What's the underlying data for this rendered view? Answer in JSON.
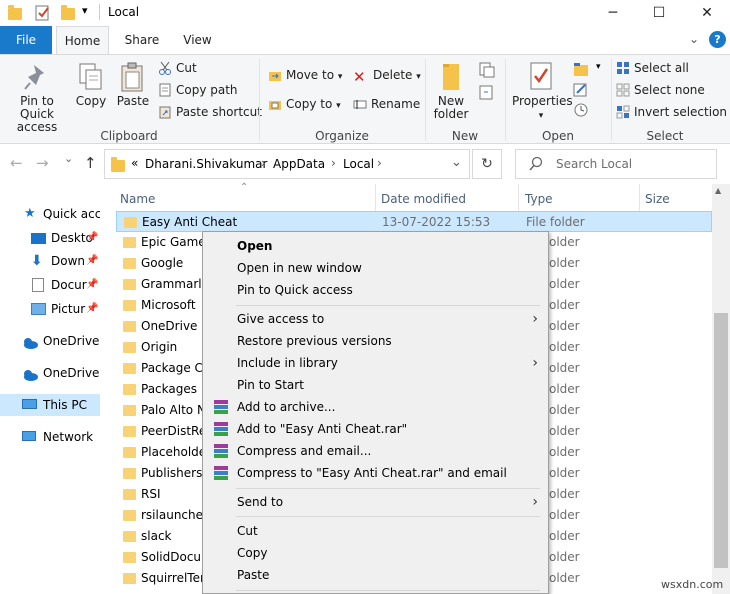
{
  "window": {
    "title": "Local",
    "minimize": "─",
    "maximize": "☐",
    "close": "✕"
  },
  "tabs": {
    "file": "File",
    "home": "Home",
    "share": "Share",
    "view": "View",
    "help": "?",
    "collapse": "⌄"
  },
  "ribbon": {
    "clipboard": {
      "pin": "Pin to Quick access",
      "copy": "Copy",
      "paste": "Paste",
      "cut": "Cut",
      "copy_path": "Copy path",
      "paste_shortcut": "Paste shortcut",
      "label": "Clipboard"
    },
    "organize": {
      "move_to": "Move to",
      "copy_to": "Copy to",
      "delete": "Delete",
      "rename": "Rename",
      "label": "Organize"
    },
    "new": {
      "new_folder": "New folder",
      "label": "New"
    },
    "open": {
      "properties": "Properties",
      "label": "Open"
    },
    "select": {
      "select_all": "Select all",
      "select_none": "Select none",
      "invert": "Invert selection",
      "label": "Select"
    }
  },
  "address": {
    "back": "←",
    "forward": "→",
    "recent": "⌄",
    "up": "↑",
    "overflow": "«",
    "crumbs": [
      "Dharani.Shivakumar",
      "AppData",
      "Local"
    ],
    "refresh": "↻",
    "search_placeholder": "Search Local"
  },
  "nav": {
    "items": [
      {
        "label": "Quick acce",
        "icon": "star-icon"
      },
      {
        "label": "Deskto",
        "icon": "desktop-icon"
      },
      {
        "label": "Down",
        "icon": "download-icon"
      },
      {
        "label": "Docur",
        "icon": "document-icon"
      },
      {
        "label": "Pictur",
        "icon": "picture-icon"
      },
      {
        "label": "OneDrive",
        "icon": "cloud-icon"
      },
      {
        "label": "OneDrive -",
        "icon": "cloud-icon"
      },
      {
        "label": "This PC",
        "icon": "computer-icon"
      },
      {
        "label": "Network",
        "icon": "network-icon"
      }
    ]
  },
  "list": {
    "headers": {
      "name": "Name",
      "date": "Date modified",
      "type": "Type",
      "size": "Size"
    },
    "rows": [
      {
        "name": "Easy Anti Cheat",
        "date": "13-07-2022 15:53",
        "type": "File folder"
      },
      {
        "name": "Epic Games",
        "type": "older"
      },
      {
        "name": "Google",
        "type": "older"
      },
      {
        "name": "Grammarly",
        "type": "older"
      },
      {
        "name": "Microsoft",
        "type": "older"
      },
      {
        "name": "OneDrive",
        "type": "older"
      },
      {
        "name": "Origin",
        "type": "older"
      },
      {
        "name": "Package Ca",
        "type": "older"
      },
      {
        "name": "Packages",
        "type": "older"
      },
      {
        "name": "Palo Alto N",
        "type": "older"
      },
      {
        "name": "PeerDistRep",
        "type": "older"
      },
      {
        "name": "Placeholder",
        "type": "older"
      },
      {
        "name": "Publishers",
        "type": "older"
      },
      {
        "name": "RSI",
        "type": "older"
      },
      {
        "name": "rsilauncher",
        "type": "older"
      },
      {
        "name": "slack",
        "type": "older"
      },
      {
        "name": "SolidDocum",
        "type": "older"
      },
      {
        "name": "SquirrelTem",
        "type": "older"
      }
    ]
  },
  "context_menu": {
    "items": [
      {
        "label": "Open"
      },
      {
        "label": "Open in new window"
      },
      {
        "label": "Pin to Quick access"
      },
      {
        "label": "Give access to",
        "submenu": "›"
      },
      {
        "label": "Restore previous versions"
      },
      {
        "label": "Include in library",
        "submenu": "›"
      },
      {
        "label": "Pin to Start"
      },
      {
        "label": "Add to archive..."
      },
      {
        "label": "Add to \"Easy Anti Cheat.rar\""
      },
      {
        "label": "Compress and email..."
      },
      {
        "label": "Compress to \"Easy Anti Cheat.rar\" and email"
      },
      {
        "label": "Send to",
        "submenu": "›"
      },
      {
        "label": "Cut"
      },
      {
        "label": "Copy"
      },
      {
        "label": "Paste"
      }
    ]
  },
  "watermark": "wsxdn.com"
}
